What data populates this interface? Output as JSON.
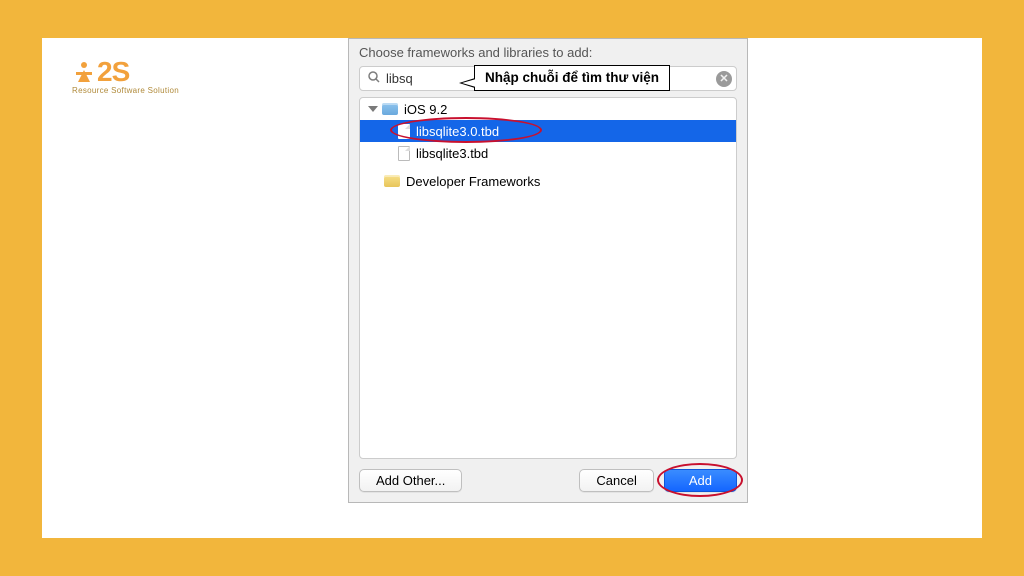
{
  "logo": {
    "text": "2S",
    "sub": "Resource Software Solution"
  },
  "dialog": {
    "title": "Choose frameworks and libraries to add:",
    "callout": "Nhập chuỗi để tìm thư viện",
    "search": {
      "value": "libsq",
      "placeholder": ""
    },
    "tree": {
      "group": "iOS 9.2",
      "items": [
        {
          "label": "libsqlite3.0.tbd",
          "selected": true
        },
        {
          "label": "libsqlite3.tbd",
          "selected": false
        }
      ],
      "subfolder": "Developer Frameworks"
    },
    "buttons": {
      "add_other": "Add Other...",
      "cancel": "Cancel",
      "add": "Add"
    }
  }
}
